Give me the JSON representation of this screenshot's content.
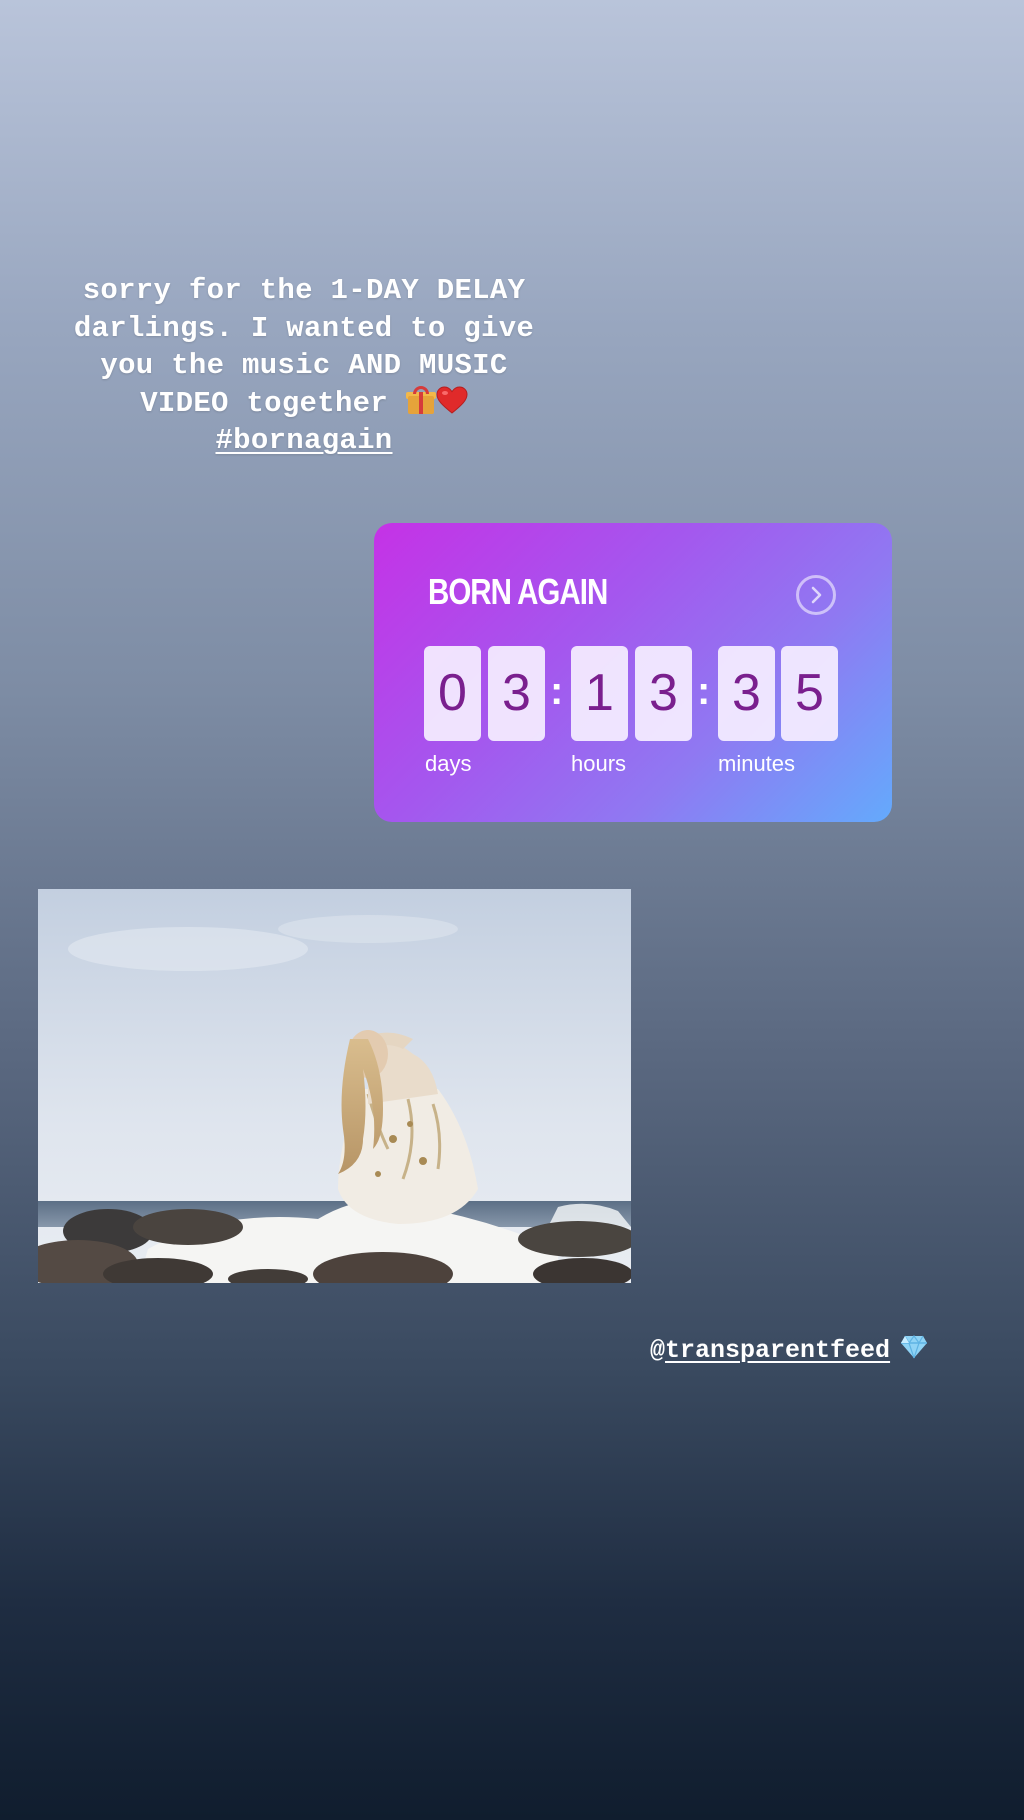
{
  "story_text": {
    "line1": "sorry for the 1-DAY DELAY",
    "line2": "darlings. I wanted to give",
    "line3": "you the music AND MUSIC",
    "line4": "VIDEO together",
    "hashtag": "#bornagain",
    "emojis": [
      "gift-icon",
      "heart-icon"
    ]
  },
  "countdown": {
    "title": "BORN AGAIN",
    "digits": {
      "days_tens": "0",
      "days_ones": "3",
      "hours_tens": "1",
      "hours_ones": "3",
      "minutes_tens": "3",
      "minutes_ones": "5"
    },
    "separator": ":",
    "labels": {
      "days": "days",
      "hours": "hours",
      "minutes": "minutes"
    },
    "gradient": [
      "#c532e6",
      "#a556ee",
      "#8f79f2",
      "#64aafc"
    ],
    "digit_color": "#7a1f8e",
    "button_icon": "chevron-right-circle-icon"
  },
  "photo": {
    "subject": "woman in white tulle gown on rocks by the sea",
    "icon": "photo"
  },
  "mention": {
    "prefix": "@",
    "handle": "transparentfeed",
    "emoji": "gem-icon"
  },
  "colors": {
    "background_top": "#b9c4da",
    "background_bottom": "#101d2e",
    "text": "#ffffff"
  }
}
